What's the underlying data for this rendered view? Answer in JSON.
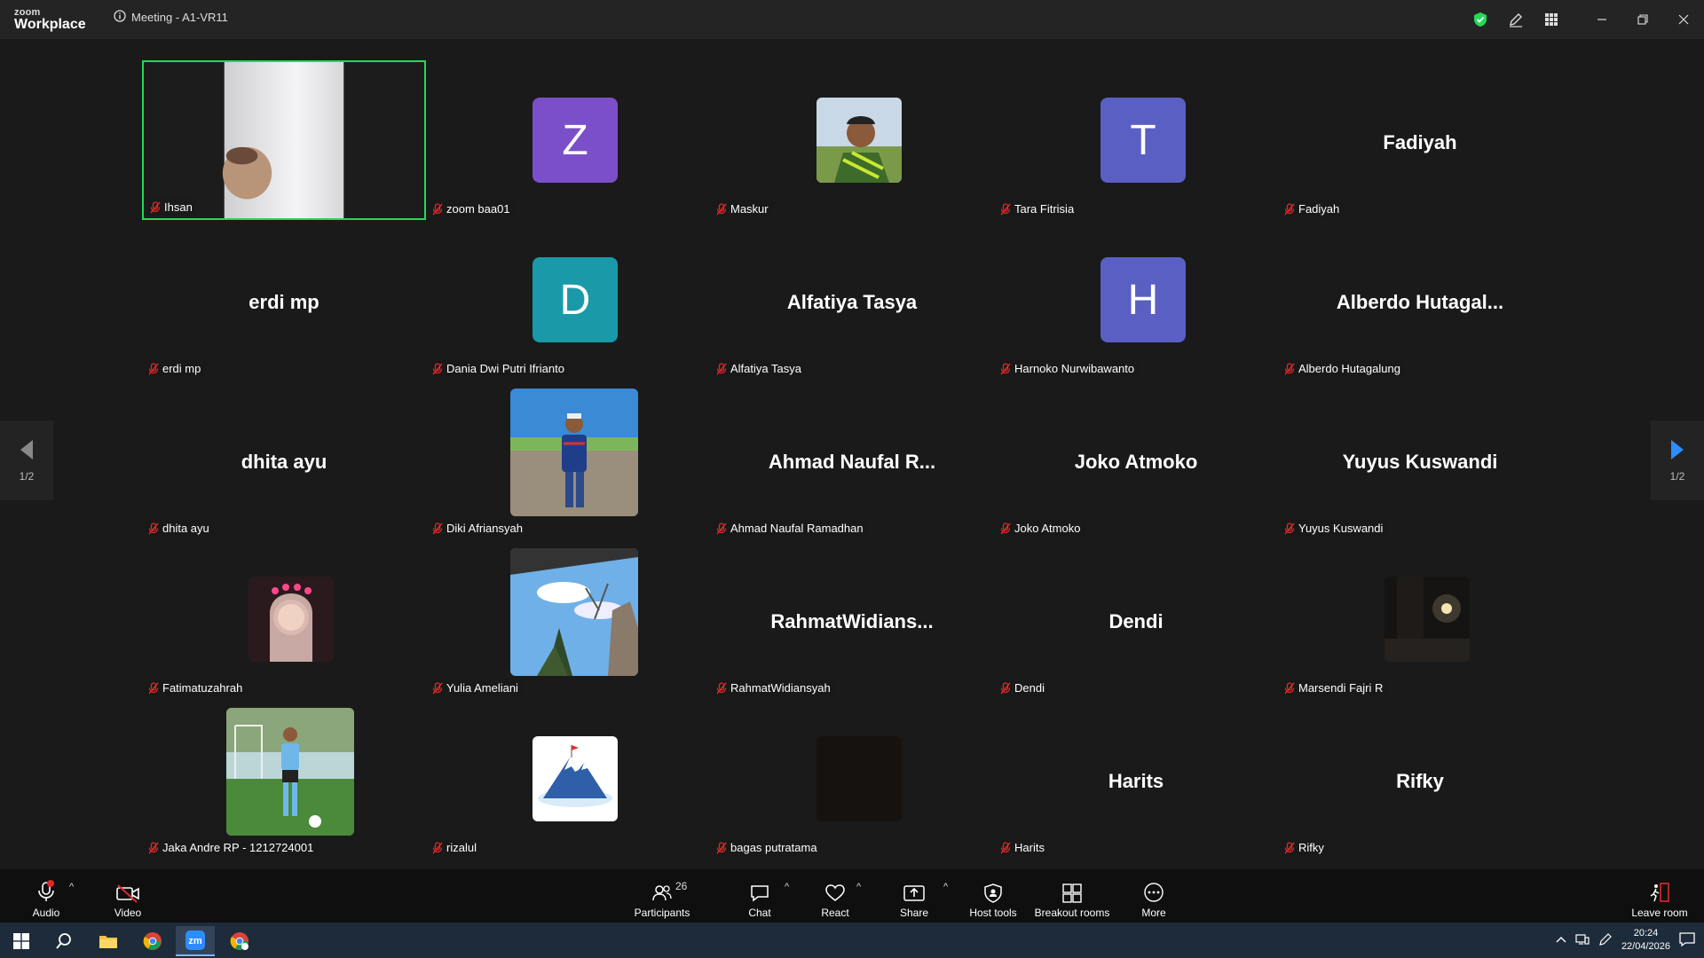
{
  "app": {
    "logo_small": "zoom",
    "logo_main": "Workplace",
    "meeting_title": "Meeting - A1-VR11"
  },
  "participants_grid": [
    {
      "tile_name": "Ihsan",
      "display": "video",
      "active": true
    },
    {
      "tile_name": "zoom baa01",
      "display": "letter",
      "letter": "Z",
      "color": "#7b4fc9"
    },
    {
      "tile_name": "Maskur",
      "display": "photo",
      "photo": "selfie-green"
    },
    {
      "tile_name": "Tara Fitrisia",
      "display": "letter",
      "letter": "T",
      "color": "#5a5fc4"
    },
    {
      "tile_name": "Fadiyah",
      "display": "name",
      "big_name": "Fadiyah"
    },
    {
      "tile_name": "erdi mp",
      "display": "name",
      "big_name": "erdi mp"
    },
    {
      "tile_name": "Dania Dwi Putri Ifrianto",
      "display": "letter",
      "letter": "D",
      "color": "#1a9aa8"
    },
    {
      "tile_name": "Alfatiya Tasya",
      "display": "name",
      "big_name": "Alfatiya Tasya"
    },
    {
      "tile_name": "Harnoko Nurwibawanto",
      "display": "letter",
      "letter": "H",
      "color": "#5a5fc4"
    },
    {
      "tile_name": "Alberdo Hutagalung",
      "display": "name",
      "big_name": "Alberdo  Hutagal..."
    },
    {
      "tile_name": "dhita ayu",
      "display": "name",
      "big_name": "dhita ayu"
    },
    {
      "tile_name": "Diki Afriansyah",
      "display": "photo-big",
      "photo": "man-track"
    },
    {
      "tile_name": "Ahmad Naufal Ramadhan",
      "display": "name",
      "big_name": "Ahmad  Naufal  R..."
    },
    {
      "tile_name": "Joko Atmoko",
      "display": "name",
      "big_name": "Joko Atmoko"
    },
    {
      "tile_name": "Yuyus Kuswandi",
      "display": "name",
      "big_name": "Yuyus Kuswandi"
    },
    {
      "tile_name": "Fatimatuzahrah",
      "display": "photo",
      "photo": "girl-pink"
    },
    {
      "tile_name": "Yulia Ameliani",
      "display": "photo-big",
      "photo": "sky-tree"
    },
    {
      "tile_name": "RahmatWidiansyah",
      "display": "name",
      "big_name": "RahmatWidians..."
    },
    {
      "tile_name": "Dendi",
      "display": "name",
      "big_name": "Dendi"
    },
    {
      "tile_name": "Marsendi Fajri R",
      "display": "photo",
      "photo": "dark-room"
    },
    {
      "tile_name": "Jaka Andre RP - 1212724001",
      "display": "photo-big",
      "photo": "football"
    },
    {
      "tile_name": "rizalul",
      "display": "photo",
      "photo": "mountain"
    },
    {
      "tile_name": "bagas putratama",
      "display": "photo",
      "photo": "black"
    },
    {
      "tile_name": "Harits",
      "display": "name",
      "big_name": "Harits"
    },
    {
      "tile_name": "Rifky",
      "display": "name",
      "big_name": "Rifky"
    }
  ],
  "pager": {
    "left_label": "1/2",
    "right_label": "1/2"
  },
  "toolbar": {
    "audio": "Audio",
    "video": "Video",
    "participants": "Participants",
    "participants_count": "26",
    "chat": "Chat",
    "react": "React",
    "share": "Share",
    "host_tools": "Host tools",
    "breakout_rooms": "Breakout rooms",
    "more": "More",
    "leave_room": "Leave room"
  },
  "taskbar": {
    "time": "20:24",
    "date": "22/04/2026"
  },
  "colors": {
    "active_border": "#23d959",
    "accent_blue": "#2d8cff",
    "muted_red": "#e02828"
  }
}
